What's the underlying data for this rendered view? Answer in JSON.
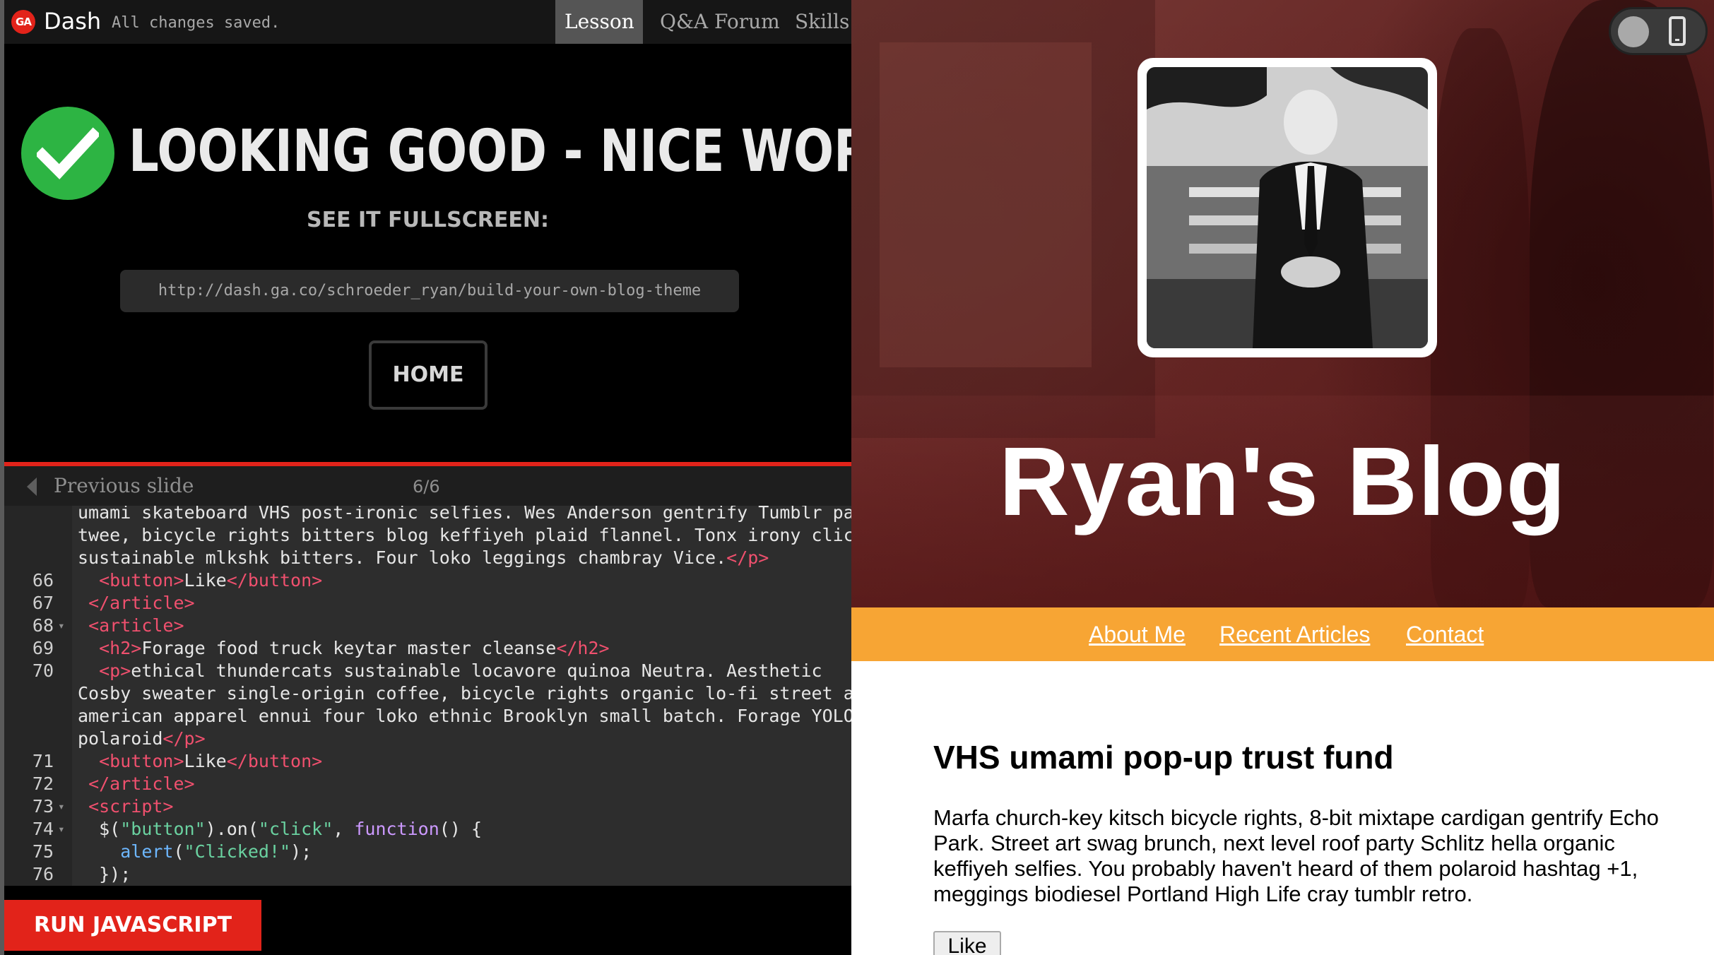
{
  "topbar": {
    "logo": "GA",
    "app_name": "Dash",
    "save_status": "All changes saved.",
    "tabs": [
      {
        "label": "Lesson"
      },
      {
        "label": "Q&A Forum"
      },
      {
        "label": "Skills"
      }
    ]
  },
  "success": {
    "title": "LOOKING GOOD - NICE WORK!",
    "subtitle": "SEE IT FULLSCREEN:",
    "url": "http://dash.ga.co/schroeder_ryan/build-your-own-blog-theme",
    "home_label": "HOME"
  },
  "slide_nav": {
    "previous_label": "Previous slide",
    "counter": "6/6"
  },
  "editor": {
    "lines": [
      {
        "num": "",
        "text": "umami skateboard VHS post-ironic selfies. Wes Anderson gentrify Tumblr pack"
      },
      {
        "num": "",
        "text": "twee, bicycle rights bitters blog keffiyeh plaid flannel. Tonx irony cliche"
      },
      {
        "num": "",
        "text": "sustainable mlkshk bitters. Four loko leggings chambray Vice.",
        "close": "</p>"
      },
      {
        "num": "66",
        "indent": "  ",
        "open": "<button>",
        "text": "Like",
        "close": "</button>"
      },
      {
        "num": "67",
        "indent": " ",
        "close": "</article>"
      },
      {
        "num": "68",
        "fold": true,
        "indent": " ",
        "open": "<article>"
      },
      {
        "num": "69",
        "indent": "  ",
        "open": "<h2>",
        "text": "Forage food truck keytar master cleanse",
        "close": "</h2>"
      },
      {
        "num": "70",
        "indent": "  ",
        "open": "<p>",
        "text": "ethical thundercats sustainable locavore quinoa Neutra. Aesthetic"
      },
      {
        "num": "",
        "text": "Cosby sweater single-origin coffee, bicycle rights organic lo-fi street art"
      },
      {
        "num": "",
        "text": "american apparel ennui four loko ethnic Brooklyn small batch. Forage YOLO"
      },
      {
        "num": "",
        "text": "polaroid",
        "close": "</p>"
      },
      {
        "num": "71",
        "indent": "  ",
        "open": "<button>",
        "text": "Like",
        "close": "</button>"
      },
      {
        "num": "72",
        "indent": " ",
        "close": "</article>"
      },
      {
        "num": "73",
        "fold": true,
        "indent": " ",
        "open": "<script>"
      },
      {
        "num": "74",
        "fold": true,
        "js": "line74"
      },
      {
        "num": "75",
        "js": "line75"
      },
      {
        "num": "76",
        "js": "line76"
      }
    ],
    "js": {
      "line74": {
        "a": "  $(",
        "s1": "\"button\"",
        "b": ").on(",
        "s2": "\"click\"",
        "c": ", ",
        "k": "function",
        "d": "() {"
      },
      "line75": {
        "a": "    ",
        "f": "alert",
        "b": "(",
        "s1": "\"Clicked!\"",
        "c": ");"
      },
      "line76": {
        "a": "  });"
      }
    }
  },
  "run_button": "RUN JAVASCRIPT",
  "blog": {
    "title": "Ryan's Blog",
    "nav": [
      "About Me",
      "Recent Articles",
      "Contact"
    ],
    "article": {
      "title": "VHS umami pop-up trust fund",
      "body": "Marfa church-key kitsch bicycle rights, 8-bit mixtape cardigan gentrify Echo Park. Street art swag brunch, next level roof party Schlitz hella organic keffiyeh selfies. You probably haven't heard of them polaroid hashtag +1, meggings biodiesel Portland High Life cray tumblr retro.",
      "like_label": "Like"
    }
  },
  "colors": {
    "accent_red": "#e2231a",
    "success_green": "#2db443",
    "nav_orange": "#f7a534",
    "code_tag": "#f0506e",
    "code_string": "#6ad1a0",
    "code_keyword": "#cc99ff",
    "code_function": "#6db7ff"
  },
  "icons": {
    "logo": "ga-logo-icon",
    "check": "checkmark-icon",
    "prev": "arrow-left-icon",
    "toggle": "toggle-switch-icon",
    "phone": "mobile-phone-icon"
  }
}
